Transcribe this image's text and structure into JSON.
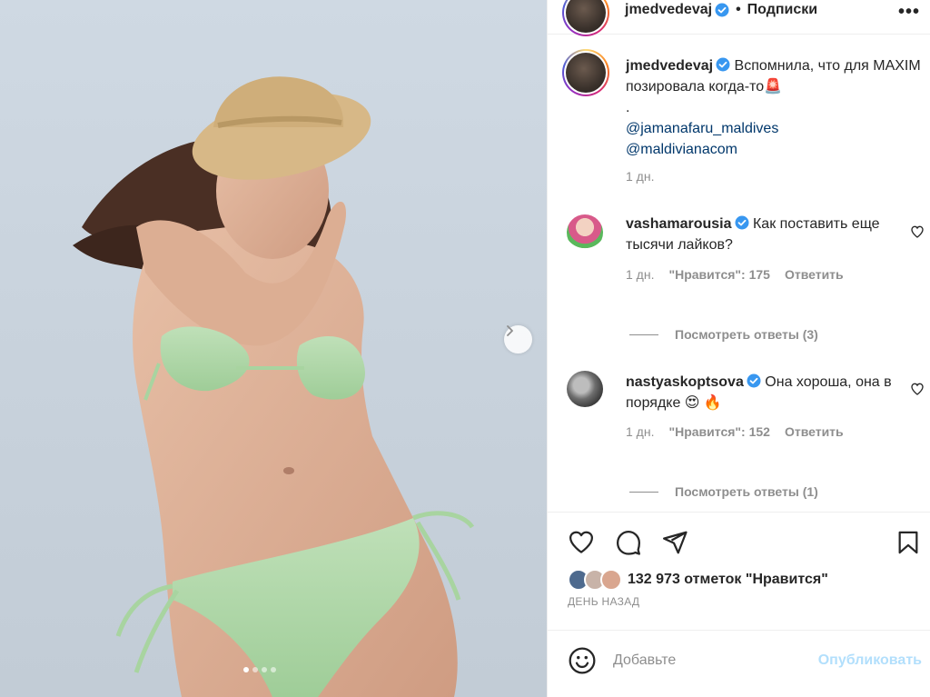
{
  "header": {
    "username": "jmedvedevaj",
    "separator": "•",
    "follow_status": "Подписки",
    "more": "•••"
  },
  "caption": {
    "username": "jmedvedevaj",
    "text": "Вспомнила, что для MAXIM позировала когда-то",
    "emoji": "🚨",
    "dot": ".",
    "mention1": "@jamanafaru_maldives",
    "mention2": "@maldivianacom",
    "time": "1 дн."
  },
  "comments": [
    {
      "username": "vashamarousia",
      "text": "Как поставить еще тысячи лайков?",
      "time": "1 дн.",
      "likes": "\"Нравится\": 175",
      "reply": "Ответить",
      "view_replies": "Посмотреть ответы (3)"
    },
    {
      "username": "nastyaskoptsova",
      "text": "Она хороша, она в порядке 😍 🔥",
      "time": "1 дн.",
      "likes": "\"Нравится\": 152",
      "reply": "Ответить",
      "view_replies": "Посмотреть ответы (1)"
    }
  ],
  "post": {
    "likes_count": "132 973 отметок \"Нравится\"",
    "time_ago": "ДЕНЬ НАЗАД",
    "carousel_total": 4,
    "carousel_index": 1
  },
  "comment_box": {
    "placeholder": "Добавьте",
    "publish": "Опубликовать"
  },
  "icons": [
    "chevron-right-icon",
    "verified-badge-icon",
    "more-icon",
    "heart-icon",
    "comment-icon",
    "share-icon",
    "bookmark-icon",
    "emoji-icon"
  ],
  "colors": {
    "verified": "#3897f0",
    "link": "#00376b",
    "publish_disabled": "#b2dffc",
    "muted": "#8e8e8e"
  }
}
